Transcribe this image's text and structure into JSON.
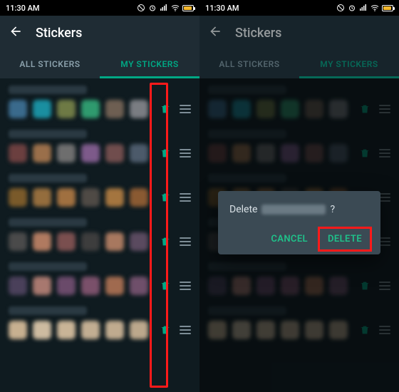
{
  "status": {
    "time": "11:30 AM"
  },
  "appbar": {
    "title": "Stickers"
  },
  "tabs": {
    "all": "ALL STICKERS",
    "mine": "MY STICKERS"
  },
  "packs_left": [
    {
      "thumbs": [
        "#3a6a8c",
        "#1a8fa0",
        "#6e7a45",
        "#2f9a6e",
        "#6e5f52",
        "#7a7d82"
      ]
    },
    {
      "thumbs": [
        "#6b3f3f",
        "#9a6f4a",
        "#6e6e6e",
        "#7d5a8a",
        "#704d4d",
        "#4c5a6a"
      ]
    },
    {
      "thumbs": [
        "#7a5a2a",
        "#946d3d",
        "#a07040",
        "#4f4a45",
        "#a4753f",
        "#8a5a32"
      ]
    },
    {
      "thumbs": [
        "#4a4a4a",
        "#b07a60",
        "#7a4f4f",
        "#3d3d3d",
        "#a8785f",
        "#5a4a5f"
      ]
    },
    {
      "thumbs": [
        "#4a405a",
        "#a8786f",
        "#6a4a6a",
        "#7a506a",
        "#a06a4f",
        "#6f4f6a"
      ]
    },
    {
      "thumbs": [
        "#c7b090",
        "#cdbba0",
        "#c9b497",
        "#c2ae92",
        "#c0ab8f",
        "#bca88c"
      ]
    }
  ],
  "packs_right": [
    {
      "thumbs": [
        "#3a6a8c",
        "#1a8fa0",
        "#6e7a45",
        "#2f9a6e",
        "#6e5f52",
        "#7a7d82"
      ]
    },
    {
      "thumbs": [
        "#6b3f3f",
        "#9a6f4a",
        "#6e6e6e",
        "#7d5a8a",
        "#704d4d",
        "#4c5a6a"
      ]
    },
    {
      "thumbs": [
        "#7a5a2a",
        "#946d3d",
        "#a07040",
        "#4f4a45",
        "#a4753f",
        "#8a5a32"
      ]
    },
    {
      "thumbs": [
        "#4a4a4a",
        "#b07a60",
        "#7a4f4f",
        "#3d3d3d",
        "#a8785f",
        "#5a4a5f"
      ]
    },
    {
      "thumbs": [
        "#4a405a",
        "#a8786f",
        "#6a4a6a",
        "#7a506a",
        "#a06a4f",
        "#6f4f6a"
      ]
    },
    {
      "thumbs": [
        "#c7b090",
        "#cdbba0",
        "#c9b497",
        "#c2ae92",
        "#c0ab8f",
        "#bca88c"
      ]
    }
  ],
  "dialog": {
    "prefix": "Delete",
    "suffix": "?",
    "cancel": "CANCEL",
    "delete": "DELETE"
  }
}
